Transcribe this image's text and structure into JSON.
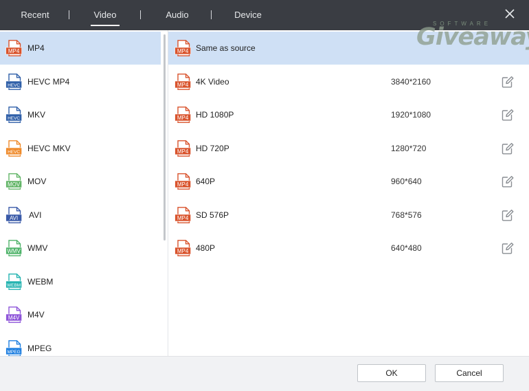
{
  "tabs": [
    {
      "label": "Recent",
      "active": false
    },
    {
      "label": "Video",
      "active": true
    },
    {
      "label": "Audio",
      "active": false
    },
    {
      "label": "Device",
      "active": false
    }
  ],
  "formats": [
    {
      "label": "MP4",
      "icon": "MP4",
      "color": "#d9532c",
      "selected": true
    },
    {
      "label": "HEVC MP4",
      "icon": "HEVC",
      "color": "#2f5fa8",
      "selected": false
    },
    {
      "label": "MKV",
      "icon": "HEVC",
      "color": "#2f5fa8",
      "selected": false
    },
    {
      "label": "HEVC MKV",
      "icon": "HEVC",
      "color": "#ef8a2a",
      "selected": false
    },
    {
      "label": "MOV",
      "icon": "MOV",
      "color": "#62b567",
      "selected": false
    },
    {
      "label": "AVI",
      "icon": "AVI",
      "color": "#3a5aa8",
      "selected": false
    },
    {
      "label": "WMV",
      "icon": "WMV",
      "color": "#4fb36a",
      "selected": false
    },
    {
      "label": "WEBM",
      "icon": "WEBM",
      "color": "#22b3b0",
      "selected": false
    },
    {
      "label": "M4V",
      "icon": "M4V",
      "color": "#8e55d9",
      "selected": false
    },
    {
      "label": "MPEG",
      "icon": "MPEG",
      "color": "#1f7fe0",
      "selected": false
    }
  ],
  "presets": [
    {
      "name": "Same as source",
      "resolution": "",
      "icon": "MP4",
      "editable": false,
      "selected": true
    },
    {
      "name": "4K Video",
      "resolution": "3840*2160",
      "icon": "MP4",
      "editable": true,
      "selected": false
    },
    {
      "name": "HD 1080P",
      "resolution": "1920*1080",
      "icon": "MP4",
      "editable": true,
      "selected": false
    },
    {
      "name": "HD 720P",
      "resolution": "1280*720",
      "icon": "MP4",
      "editable": true,
      "selected": false
    },
    {
      "name": "640P",
      "resolution": "960*640",
      "icon": "MP4",
      "editable": true,
      "selected": false
    },
    {
      "name": "SD 576P",
      "resolution": "768*576",
      "icon": "MP4",
      "editable": true,
      "selected": false
    },
    {
      "name": "480P",
      "resolution": "640*480",
      "icon": "MP4",
      "editable": true,
      "selected": false
    }
  ],
  "preset_icon_color": "#d9532c",
  "footer": {
    "ok_label": "OK",
    "cancel_label": "Cancel"
  },
  "watermark": {
    "top": "SOFTWARE",
    "main": "Giveaway"
  },
  "colors": {
    "header_bg": "#3a3d43",
    "selection_bg": "#cfe0f5"
  }
}
